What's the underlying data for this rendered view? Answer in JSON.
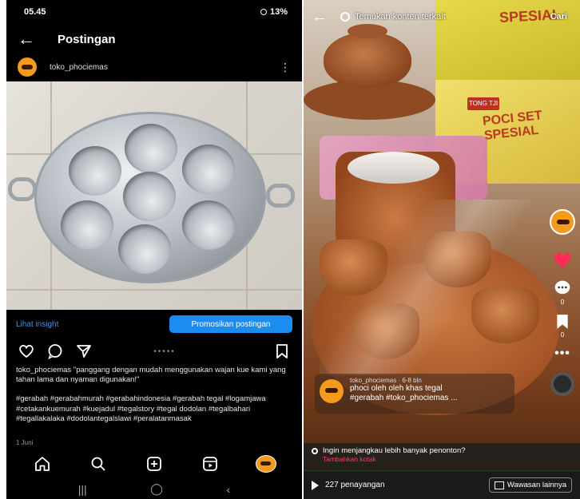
{
  "left": {
    "status": {
      "time": "05.45",
      "battery": "13%"
    },
    "appbar": {
      "title": "Postingan"
    },
    "account": {
      "username": "toko_phociemas"
    },
    "insight_link": "Lihat insight",
    "promote_button": "Promosikan postingan",
    "caption": "toko_phociemas \"panggang dengan mudah menggunakan wajan kue kami yang tahan lama dan nyaman digunakan!\"",
    "hashtags": "#gerabah #gerabahmurah #gerabahindonesia #gerabah tegal #logamjawa #cetakankuemurah #kuejadul #tegalstory #tegal dodolan #tegalbahari #tegallakalaka #dodolantegalslawi #peralatanmasak",
    "date": "1 Juni"
  },
  "right": {
    "search_placeholder": "Temukan konten terkait",
    "search_button": "Cari",
    "package_text": {
      "top": "SPESIAL",
      "brand": "TONG TJI",
      "poci": "POCI SET",
      "spesial": "SPESIAL"
    },
    "rail": {
      "like_count": "",
      "comment_count": "0",
      "save_count": "0"
    },
    "card": {
      "meta": "toko_phociemas · 6-8 bln",
      "line1": "phoci oleh oleh khas tegal",
      "line2": "#gerabah #toko_phociemas ..."
    },
    "promo": {
      "question": "Ingin menjangkau lebih banyak penonton?",
      "link": "Tambahkan kotak"
    },
    "views": "227 penayangan",
    "insight_button": "Wawasan lainnya"
  },
  "colors": {
    "instagram_blue": "#1d8cf0",
    "link_blue": "#4a8fe7",
    "tiktok_red": "#ff3b5c",
    "avatar_orange": "#f39a1f"
  },
  "icons": [
    "back-arrow-icon",
    "more-vertical-icon",
    "heart-icon",
    "comment-icon",
    "share-icon",
    "bookmark-icon",
    "home-icon",
    "search-icon",
    "add-icon",
    "reels-icon",
    "play-icon"
  ]
}
